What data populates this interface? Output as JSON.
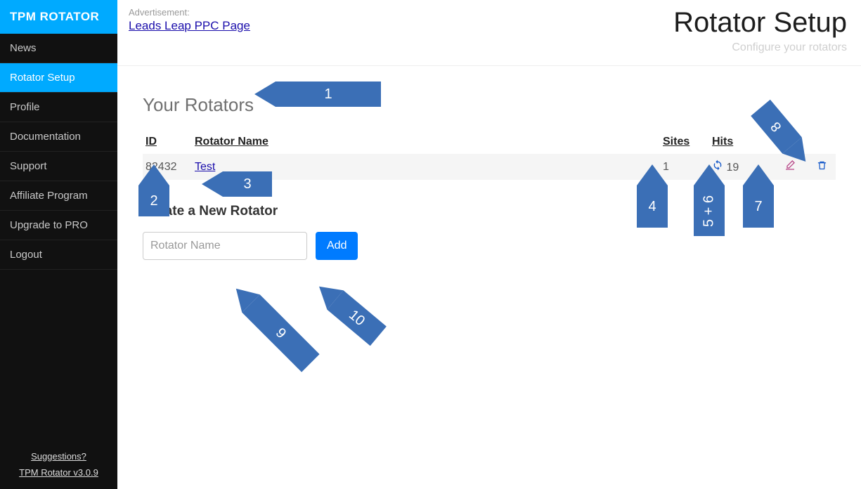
{
  "brand": "TPM ROTATOR",
  "nav": [
    {
      "label": "News",
      "active": false
    },
    {
      "label": "Rotator Setup",
      "active": true
    },
    {
      "label": "Profile",
      "active": false
    },
    {
      "label": "Documentation",
      "active": false
    },
    {
      "label": "Support",
      "active": false
    },
    {
      "label": "Affiliate Program",
      "active": false
    },
    {
      "label": "Upgrade to PRO",
      "active": false
    },
    {
      "label": "Logout",
      "active": false
    }
  ],
  "sidebar_footer": {
    "suggestions": "Suggestions?",
    "version": "TPM Rotator v3.0.9"
  },
  "advertisement": {
    "label": "Advertisement:",
    "link_text": "Leads Leap PPC Page"
  },
  "page": {
    "title": "Rotator Setup",
    "subtitle": "Configure your rotators"
  },
  "rotators": {
    "section_title": "Your Rotators",
    "headers": {
      "id": "ID",
      "name": "Rotator Name",
      "sites": "Sites",
      "hits": "Hits"
    },
    "rows": [
      {
        "id": "82432",
        "name": "Test",
        "sites": "1",
        "hits": "19"
      }
    ]
  },
  "create": {
    "title": "Create a New Rotator",
    "placeholder": "Rotator Name",
    "button": "Add"
  },
  "annotations": {
    "a1": "1",
    "a2": "2",
    "a3": "3",
    "a4": "4",
    "a56": "5 + 6",
    "a7": "7",
    "a8": "8",
    "a9": "9",
    "a10": "10"
  }
}
